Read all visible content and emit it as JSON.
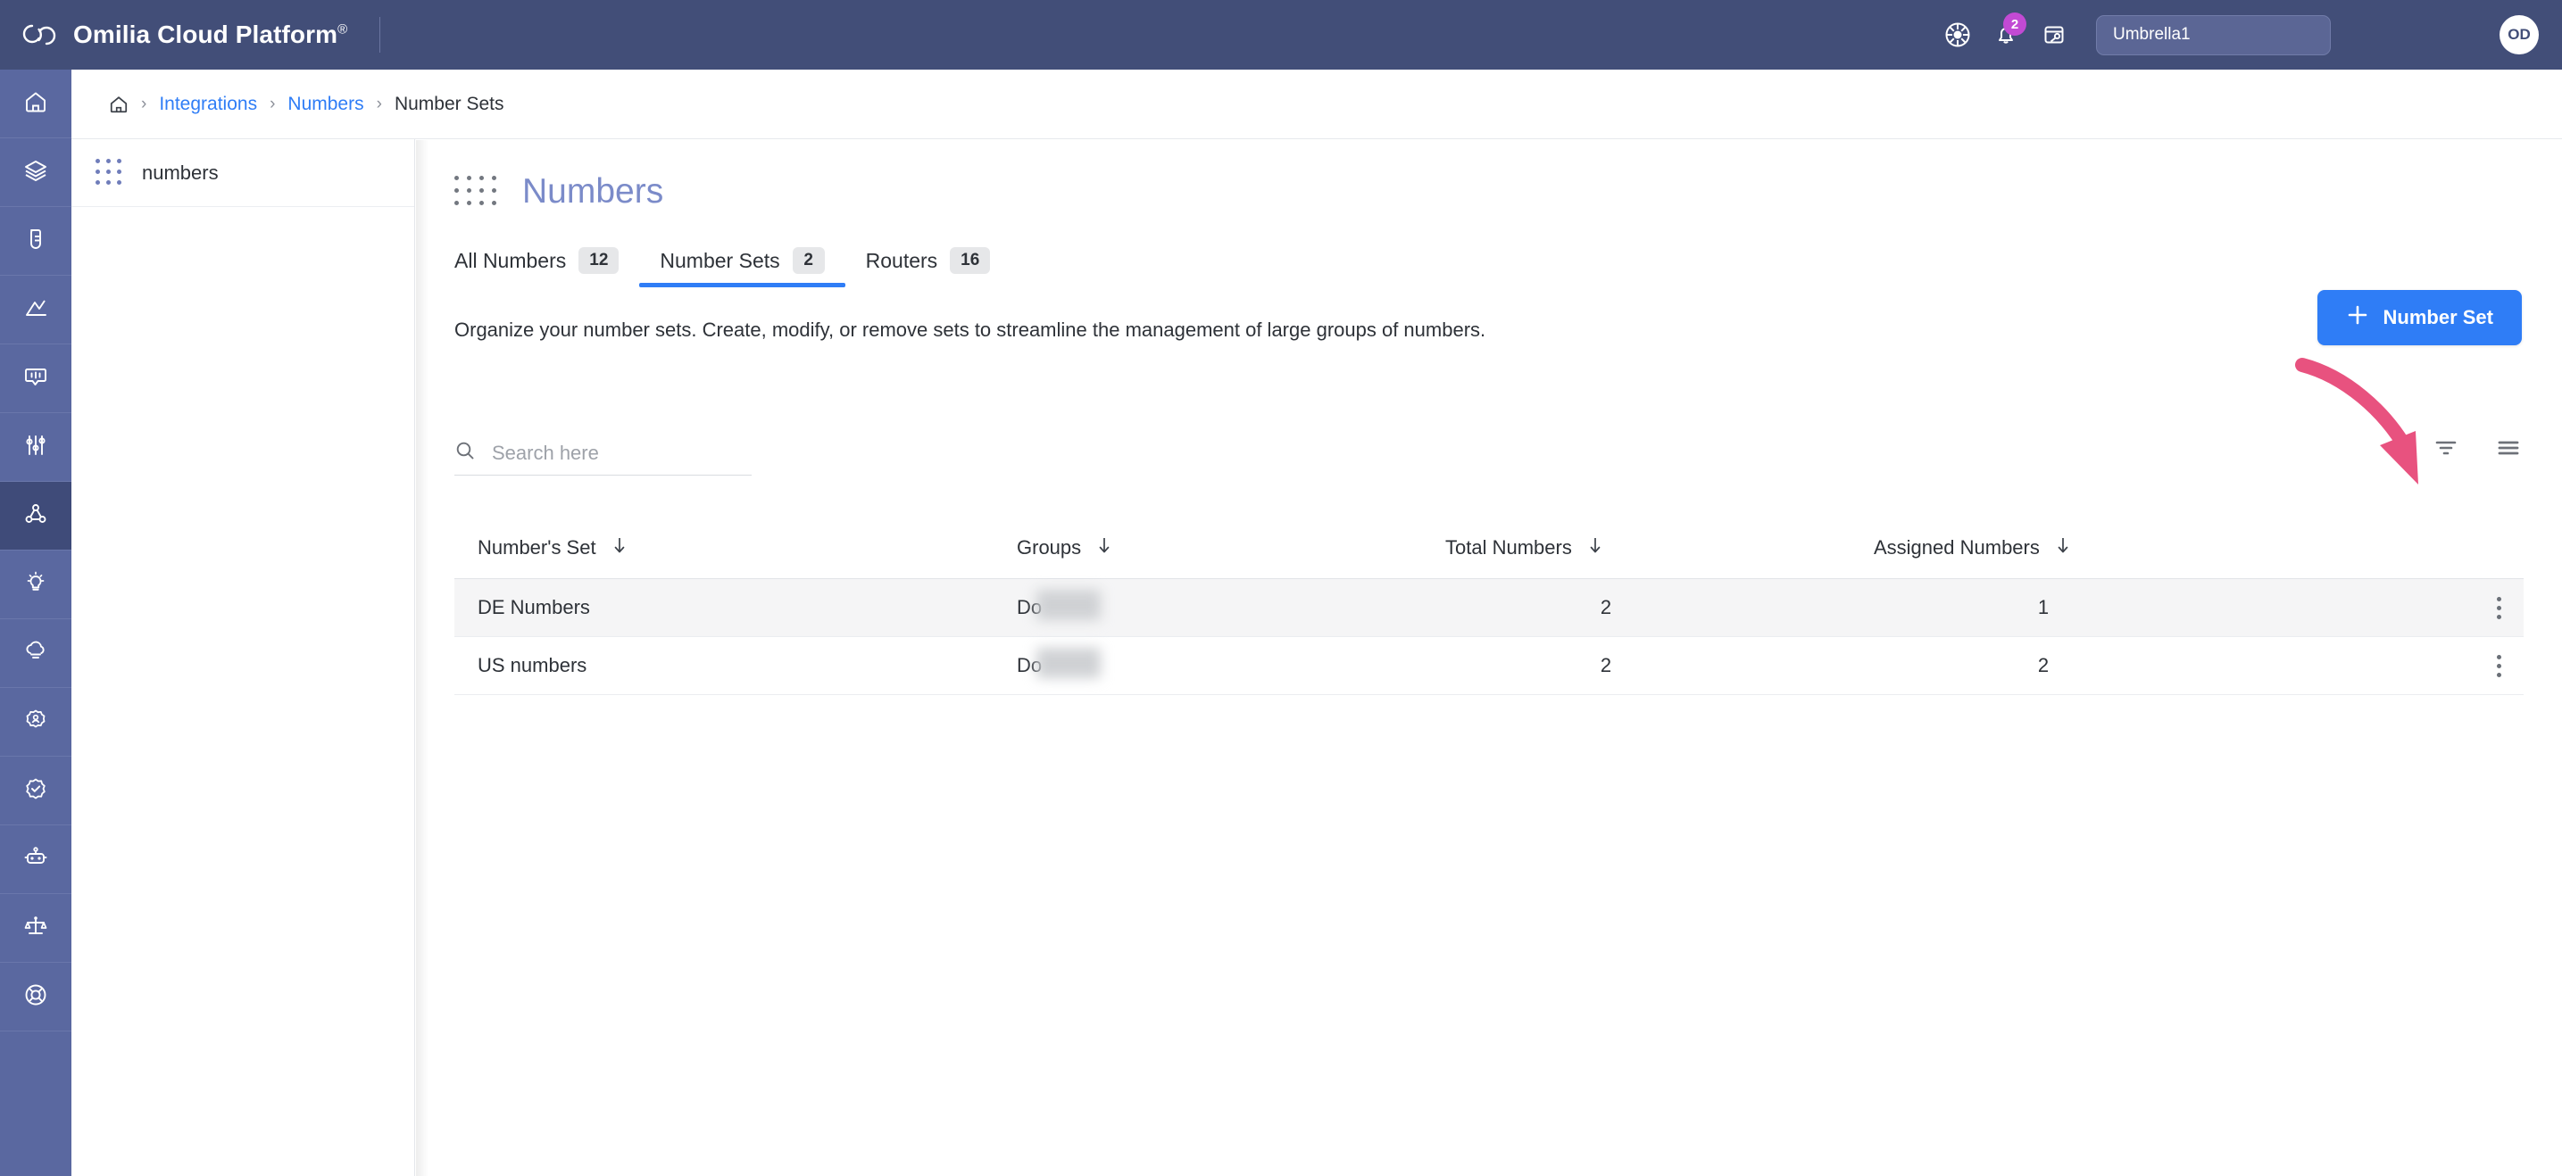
{
  "header": {
    "brand": "Omilia Cloud Platform",
    "brand_mark": "®",
    "logo_icon": "cloud-logo-icon",
    "theme_icon": "theme-wheel-icon",
    "notifications_icon": "bell-icon",
    "notifications_count": "2",
    "license_icon": "license-key-icon",
    "tenant": "Umbrella1",
    "avatar_initials": "OD",
    "badge_color": "#c24ad4",
    "bar_color": "#424e78"
  },
  "rail": {
    "items": [
      {
        "name": "home",
        "icon": "home-icon",
        "active": false
      },
      {
        "name": "layers",
        "icon": "layers-icon",
        "active": false
      },
      {
        "name": "voice",
        "icon": "microphone-box-icon",
        "active": false
      },
      {
        "name": "analytics",
        "icon": "analytics-chart-icon",
        "active": false
      },
      {
        "name": "transcripts",
        "icon": "chat-bubble-icon",
        "active": false
      },
      {
        "name": "tuning",
        "icon": "sliders-icon",
        "active": false
      },
      {
        "name": "integrations",
        "icon": "nodes-network-icon",
        "active": true
      },
      {
        "name": "insights",
        "icon": "lightbulb-icon",
        "active": false
      },
      {
        "name": "cloud",
        "icon": "cloud-icon",
        "active": false
      },
      {
        "name": "user-settings",
        "icon": "gear-user-icon",
        "active": false
      },
      {
        "name": "compliance",
        "icon": "badge-check-icon",
        "active": false
      },
      {
        "name": "bots",
        "icon": "robot-icon",
        "active": false
      },
      {
        "name": "governance",
        "icon": "scales-icon",
        "active": false
      },
      {
        "name": "support",
        "icon": "lifebuoy-icon",
        "active": false
      }
    ]
  },
  "subpanel": {
    "items": [
      {
        "label": "numbers",
        "icon": "dots-grid-icon"
      }
    ]
  },
  "breadcrumb": {
    "home_icon": "home-icon",
    "separator": "›",
    "items": [
      {
        "label": "Integrations",
        "link": true
      },
      {
        "label": "Numbers",
        "link": true
      },
      {
        "label": "Number Sets",
        "link": false
      }
    ]
  },
  "page": {
    "title": "Numbers",
    "title_icon": "dots-grid-icon",
    "title_color": "#7b8bc9",
    "description": "Organize your number sets. Create, modify, or remove sets to streamline the management of large groups of numbers.",
    "primary_button": {
      "label": "Number Set",
      "icon": "plus-icon",
      "color": "#2f7df6"
    }
  },
  "tabs": [
    {
      "label": "All Numbers",
      "count": "12",
      "active": false
    },
    {
      "label": "Number Sets",
      "count": "2",
      "active": true
    },
    {
      "label": "Routers",
      "count": "16",
      "active": false
    }
  ],
  "search": {
    "icon": "search-icon",
    "value": "",
    "placeholder": "Search here"
  },
  "toolbar": {
    "filter_icon": "filter-icon",
    "list-view_icon": "list-view-icon",
    "annotation": {
      "type": "arrow",
      "color": "#e8527f",
      "points_to": "list-view-icon"
    }
  },
  "table": {
    "columns": [
      {
        "label": "Number's Set",
        "sort_icon": "arrow-down-icon"
      },
      {
        "label": "Groups",
        "sort_icon": "arrow-down-icon"
      },
      {
        "label": "Total Numbers",
        "sort_icon": "arrow-down-icon"
      },
      {
        "label": "Assigned Numbers",
        "sort_icon": "arrow-down-icon"
      }
    ],
    "rows": [
      {
        "set": "DE Numbers",
        "groups": "Do",
        "total": "2",
        "assigned": "1",
        "menu_icon": "kebab-menu-icon"
      },
      {
        "set": "US numbers",
        "groups": "Do",
        "total": "2",
        "assigned": "2",
        "menu_icon": "kebab-menu-icon"
      }
    ]
  }
}
